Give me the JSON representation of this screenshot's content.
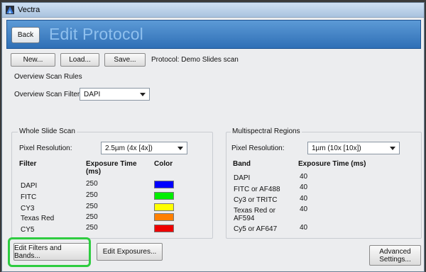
{
  "window": {
    "title": "Vectra"
  },
  "header": {
    "back_label": "Back",
    "title": "Edit Protocol"
  },
  "toolbar": {
    "new_label": "New...",
    "load_label": "Load...",
    "save_label": "Save...",
    "protocol_text": "Protocol: Demo Slides scan"
  },
  "overview": {
    "group_title": "Overview Scan Rules",
    "filter_label": "Overview Scan Filter:",
    "filter_value": "DAPI"
  },
  "whole_slide": {
    "group_title": "Whole Slide Scan",
    "resolution_label": "Pixel Resolution:",
    "resolution_value": "2.5µm (4x [4x])",
    "col_filter": "Filter",
    "col_exposure": "Exposure Time\n(ms)",
    "col_color": "Color",
    "rows": [
      {
        "name": "DAPI",
        "exposure": "250",
        "color": "#0000ff"
      },
      {
        "name": "FITC",
        "exposure": "250",
        "color": "#00ee00"
      },
      {
        "name": "CY3",
        "exposure": "250",
        "color": "#ffff00"
      },
      {
        "name": "Texas Red",
        "exposure": "250",
        "color": "#ff8000"
      },
      {
        "name": "CY5",
        "exposure": "250",
        "color": "#ee0000"
      }
    ]
  },
  "multispectral": {
    "group_title": "Multispectral Regions",
    "resolution_label": "Pixel Resolution:",
    "resolution_value": "1µm (10x [10x])",
    "col_band": "Band",
    "col_exposure": "Exposure Time (ms)",
    "rows": [
      {
        "name": "DAPI",
        "exposure": "40"
      },
      {
        "name": "FITC or AF488",
        "exposure": "40"
      },
      {
        "name": "Cy3 or TRITC",
        "exposure": "40"
      },
      {
        "name": "Texas Red or\nAF594",
        "exposure": "40"
      },
      {
        "name": "Cy5 or AF647",
        "exposure": "40"
      }
    ]
  },
  "footer": {
    "edit_filters_label": "Edit Filters and Bands...",
    "edit_exposures_label": "Edit Exposures...",
    "advanced_label": "Advanced\nSettings..."
  },
  "colors": {
    "highlight": "#2ecc40",
    "header_bg": "#2f6fb6"
  }
}
